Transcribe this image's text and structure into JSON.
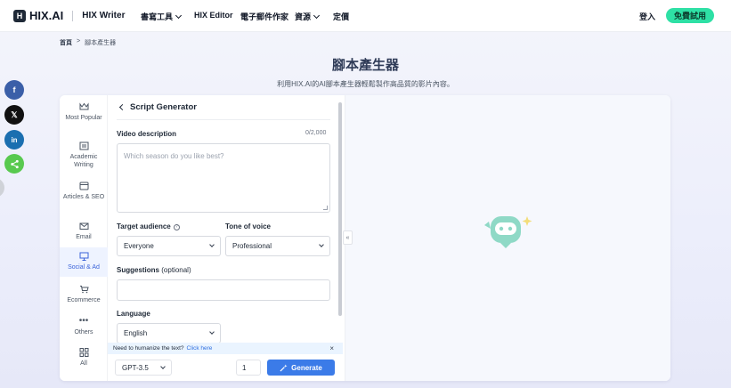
{
  "nav": {
    "logo_text": "HIX.AI",
    "logo_sub": "HIX Writer",
    "items": [
      {
        "label": "書寫工具",
        "has_dropdown": true
      },
      {
        "label": "HIX Editor",
        "has_dropdown": false
      },
      {
        "label": "電子郵件作家",
        "has_dropdown": false
      },
      {
        "label": "資源",
        "has_dropdown": true
      },
      {
        "label": "定價",
        "has_dropdown": false
      }
    ],
    "login": "登入",
    "signup": "免費試用"
  },
  "breadcrumb": {
    "home": "首頁",
    "sep": ">",
    "current": "腳本產生器"
  },
  "page": {
    "title": "腳本產生器",
    "subtitle": "利用HIX.AI的AI腳本產生器輕鬆製作高品質的影片內容。"
  },
  "categories": [
    {
      "label": "Most Popular",
      "icon": "crown-icon"
    },
    {
      "label": "Academic Writing",
      "icon": "academic-icon"
    },
    {
      "label": "Articles & SEO",
      "icon": "article-icon"
    },
    {
      "label": "Email",
      "icon": "email-icon"
    },
    {
      "label": "Social & Ad",
      "icon": "social-ad-icon",
      "active": true
    },
    {
      "label": "Ecommerce",
      "icon": "cart-icon"
    },
    {
      "label": "Others",
      "icon": "more-icon"
    },
    {
      "label": "All",
      "icon": "grid-icon"
    }
  ],
  "form": {
    "header": "Script Generator",
    "video_description": {
      "label": "Video description",
      "counter": "0/2,000",
      "placeholder": "Which season do you like best?"
    },
    "target_audience": {
      "label": "Target audience",
      "value": "Everyone"
    },
    "tone_of_voice": {
      "label": "Tone of voice",
      "value": "Professional"
    },
    "suggestions": {
      "label": "Suggestions",
      "label_optional": "(optional)",
      "value": ""
    },
    "language": {
      "label": "Language",
      "value": "English"
    }
  },
  "notice": {
    "text": "Need to humanize the text?",
    "link": "Click here",
    "close": "×"
  },
  "footer": {
    "model": "GPT-3.5",
    "count": "1",
    "generate": "Generate"
  },
  "colors": {
    "accent": "#3b7be8",
    "signup_bg": "#2ee0a5",
    "active_category": "#3b63d9"
  }
}
